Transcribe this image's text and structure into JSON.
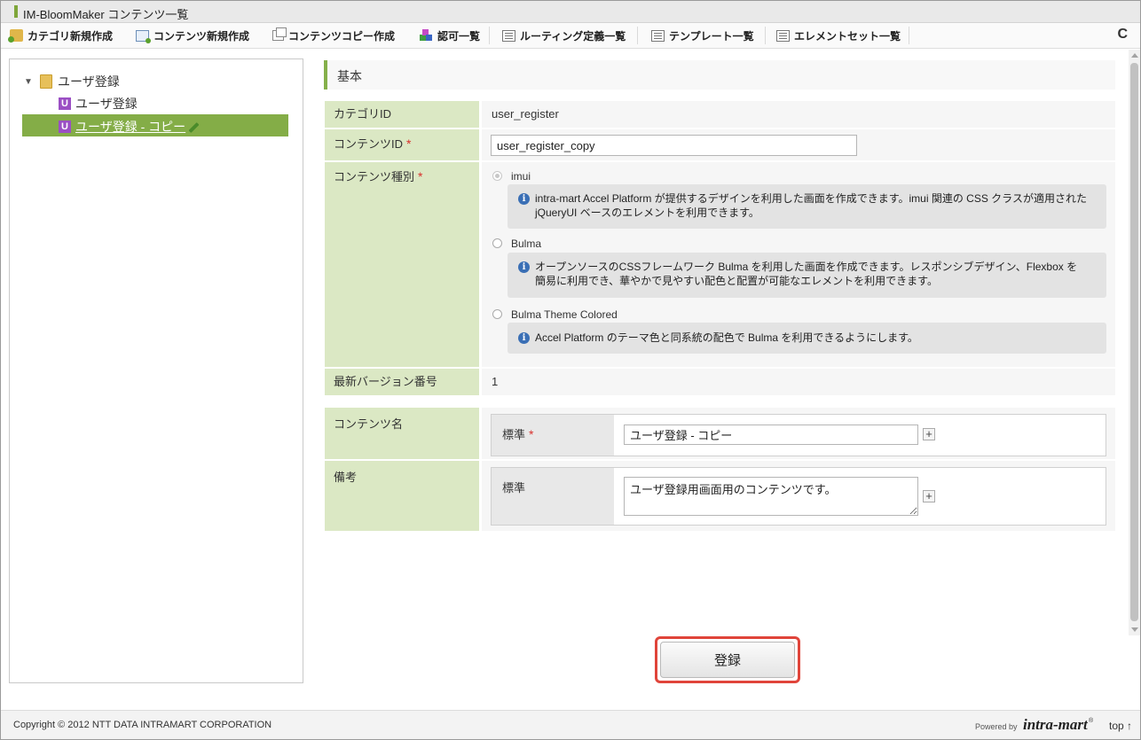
{
  "window": {
    "title": "IM-BloomMaker コンテンツ一覧"
  },
  "toolbar": {
    "items": [
      {
        "label": "カテゴリ新規作成",
        "icon": "folder-add-icon"
      },
      {
        "label": "コンテンツ新規作成",
        "icon": "content-add-icon"
      },
      {
        "label": "コンテンツコピー作成",
        "icon": "copy-icon"
      },
      {
        "label": "認可一覧",
        "icon": "authorization-icon"
      },
      {
        "label": "ルーティング定義一覧",
        "icon": "list-icon"
      },
      {
        "label": "テンプレート一覧",
        "icon": "list-icon"
      },
      {
        "label": "エレメントセット一覧",
        "icon": "list-icon"
      }
    ],
    "refresh_icon": "C"
  },
  "tree": {
    "folder_label": "ユーザ登録",
    "items": [
      {
        "badge": "U",
        "label": "ユーザ登録"
      },
      {
        "badge": "U",
        "label": "ユーザ登録 - コピー"
      }
    ]
  },
  "form": {
    "section_title": "基本",
    "category_id_label": "カテゴリID",
    "category_id_value": "user_register",
    "content_id_label": "コンテンツID",
    "content_id_value": "user_register_copy",
    "content_type_label": "コンテンツ種別",
    "content_types": [
      {
        "label": "imui",
        "checked": true,
        "desc_lines": [
          "intra-mart Accel Platform が提供するデザインを利用した画面を作成できます。imui 関連の CSS クラスが適用された",
          "jQueryUI ベースのエレメントを利用できます。"
        ]
      },
      {
        "label": "Bulma",
        "checked": false,
        "desc_lines": [
          "オープンソースのCSSフレームワーク Bulma を利用した画面を作成できます。レスポンシブデザイン、Flexbox を",
          "簡易に利用でき、華やかで見やすい配色と配置が可能なエレメントを利用できます。"
        ]
      },
      {
        "label": "Bulma Theme Colored",
        "checked": false,
        "desc_lines": [
          "Accel Platform のテーマ色と同系統の配色で Bulma を利用できるようにします。"
        ]
      }
    ],
    "latest_version_label": "最新バージョン番号",
    "latest_version_value": "1",
    "content_name_label": "コンテンツ名",
    "content_name_locale": "標準",
    "content_name_value": "ユーザ登録 - コピー",
    "remarks_label": "備考",
    "remarks_locale": "標準",
    "remarks_value": "ユーザ登録用画面用のコンテンツです。",
    "required_mark": "*",
    "add_mark": "+"
  },
  "buttons": {
    "register": "登録"
  },
  "footer": {
    "copyright": "Copyright © 2012 NTT DATA INTRAMART CORPORATION",
    "powered_by": "Powered by",
    "brand": "intra-mart",
    "brand_mark": "®",
    "top_link": "top ↑"
  },
  "colors": {
    "accent": "#85b04a",
    "label_bg": "#dbe8c4",
    "highlight": "#e0443a",
    "selection": "#84ad47"
  }
}
